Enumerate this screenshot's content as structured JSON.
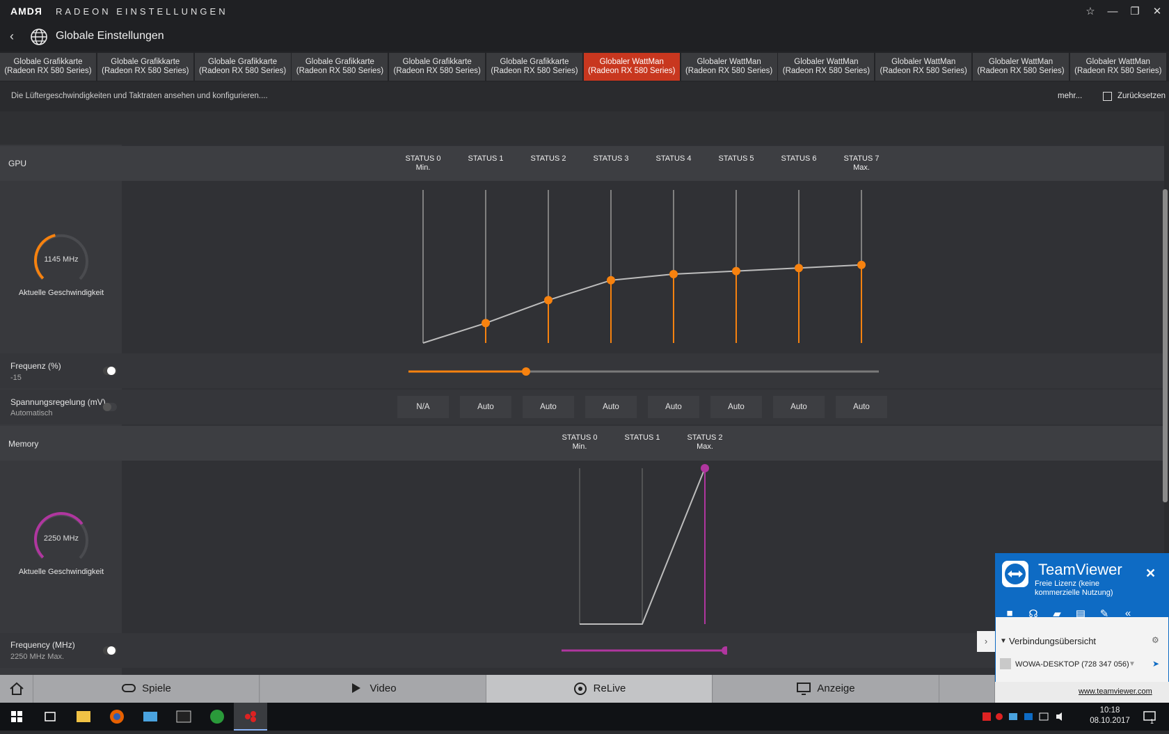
{
  "titlebar": {
    "brand": "AMDЯ",
    "title": "RADEON EINSTELLUNGEN"
  },
  "header": {
    "title": "Globale Einstellungen"
  },
  "tabs": [
    {
      "line1": "Globale Grafikkarte",
      "line2": "(Radeon RX 580 Series)"
    },
    {
      "line1": "Globale Grafikkarte",
      "line2": "(Radeon RX 580 Series)"
    },
    {
      "line1": "Globale Grafikkarte",
      "line2": "(Radeon RX 580 Series)"
    },
    {
      "line1": "Globale Grafikkarte",
      "line2": "(Radeon RX 580 Series)"
    },
    {
      "line1": "Globale Grafikkarte",
      "line2": "(Radeon RX 580 Series)"
    },
    {
      "line1": "Globale Grafikkarte",
      "line2": "(Radeon RX 580 Series)"
    },
    {
      "line1": "Globaler WattMan",
      "line2": "(Radeon RX 580 Series)",
      "active": true
    },
    {
      "line1": "Globaler WattMan",
      "line2": "(Radeon RX 580 Series)"
    },
    {
      "line1": "Globaler WattMan",
      "line2": "(Radeon RX 580 Series)"
    },
    {
      "line1": "Globaler WattMan",
      "line2": "(Radeon RX 580 Series)"
    },
    {
      "line1": "Globaler WattMan",
      "line2": "(Radeon RX 580 Series)"
    },
    {
      "line1": "Globaler WattMan",
      "line2": "(Radeon RX 580 Series)"
    }
  ],
  "subbar": {
    "description": "Die Lüftergeschwindigkeiten und Taktraten ansehen und konfigurieren....",
    "more": "mehr...",
    "reset": "Zurücksetzen"
  },
  "gpu": {
    "label": "GPU",
    "gauge_value": "1145 MHz",
    "gauge_label": "Aktuelle Geschwindigkeit",
    "gauge_fraction": 0.45,
    "states": [
      {
        "name": "STATUS 0",
        "sub": "Min."
      },
      {
        "name": "STATUS 1",
        "sub": ""
      },
      {
        "name": "STATUS 2",
        "sub": ""
      },
      {
        "name": "STATUS 3",
        "sub": ""
      },
      {
        "name": "STATUS 4",
        "sub": ""
      },
      {
        "name": "STATUS 5",
        "sub": ""
      },
      {
        "name": "STATUS 6",
        "sub": ""
      },
      {
        "name": "STATUS 7",
        "sub": "Max."
      }
    ],
    "state_levels": [
      0.0,
      0.13,
      0.28,
      0.41,
      0.45,
      0.47,
      0.49,
      0.51
    ],
    "frequency_label": "Frequenz (%)",
    "frequency_value": "-15",
    "frequency_slider": 0.25,
    "voltage_label": "Spannungsregelung (mV)",
    "voltage_sub": "Automatisch",
    "voltages": [
      "N/A",
      "Auto",
      "Auto",
      "Auto",
      "Auto",
      "Auto",
      "Auto",
      "Auto"
    ],
    "color": "#f7820f"
  },
  "memory": {
    "label": "Memory",
    "gauge_value": "2250 MHz",
    "gauge_label": "Aktuelle Geschwindigkeit",
    "gauge_fraction": 0.7,
    "states": [
      {
        "name": "STATUS 0",
        "sub": "Min."
      },
      {
        "name": "STATUS 1",
        "sub": ""
      },
      {
        "name": "STATUS 2",
        "sub": "Max."
      }
    ],
    "state_levels": [
      0.0,
      0.0,
      1.0
    ],
    "frequency_label": "Frequency (MHz)",
    "frequency_value": "2250 MHz Max.",
    "frequency_slider": 1.0,
    "color": "#b0369f"
  },
  "bottomnav": [
    {
      "label": "Spiele",
      "icon": "gamepad-icon"
    },
    {
      "label": "Video",
      "icon": "play-icon"
    },
    {
      "label": "ReLive",
      "icon": "relive-icon",
      "active": true
    },
    {
      "label": "Anzeige",
      "icon": "monitor-icon"
    }
  ],
  "teamviewer": {
    "title": "TeamViewer",
    "subtitle": "Freie Lizenz (keine kommerzielle Nutzung)",
    "section": "Verbindungsübersicht",
    "peer": "WOWA-DESKTOP (728 347 056)",
    "link": "www.teamviewer.com"
  },
  "taskbar": {
    "time": "10:18",
    "date": "08.10.2017",
    "notifications": "1"
  }
}
